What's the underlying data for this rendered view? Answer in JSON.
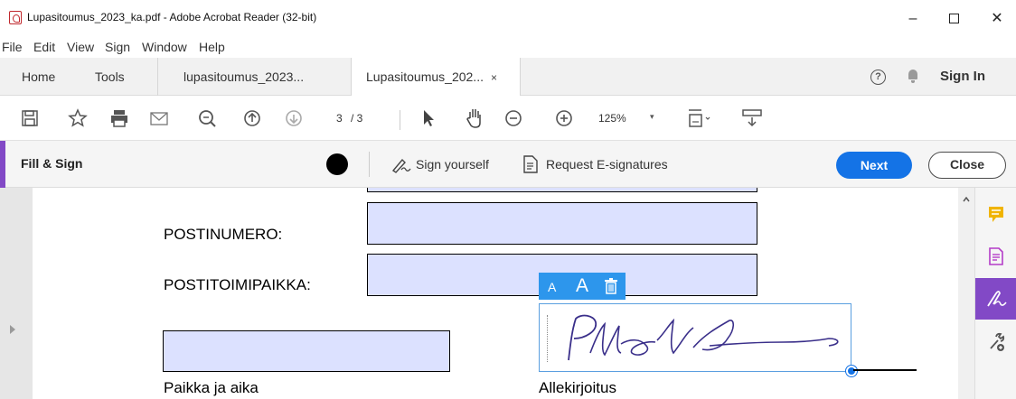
{
  "window": {
    "title": "Lupasitoumus_2023_ka.pdf - Adobe Acrobat Reader (32-bit)",
    "minimize": "–",
    "close": "✕"
  },
  "menu": [
    "File",
    "Edit",
    "View",
    "Sign",
    "Window",
    "Help"
  ],
  "tabs": {
    "home": "Home",
    "tools": "Tools",
    "doc1": "lupasitoumus_2023...",
    "doc2": "Lupasitoumus_202...",
    "doc2_close": "×",
    "help_icon": "?",
    "signin": "Sign In"
  },
  "toolbar": {
    "icons": [
      "save-icon",
      "bookmark-star-icon",
      "print-icon",
      "email-icon",
      "find-zoom-icon",
      "page-up-icon",
      "page-down-icon",
      "select-pointer-icon",
      "hand-tool-icon",
      "zoom-out-icon",
      "zoom-in-icon",
      "fit-page-icon",
      "scroll-mode-icon"
    ],
    "page_current": "3",
    "page_total": "/ 3",
    "zoom": "125%",
    "zoom_caret": "▾"
  },
  "fillsign": {
    "title": "Fill & Sign",
    "sign_yourself": "Sign yourself",
    "request": "Request E-signatures",
    "next": "Next",
    "close": "Close",
    "ink_color": "#000000",
    "accent": "#8249c6"
  },
  "document": {
    "postinumero": "POSTINUMERO:",
    "postitoimipaikka": "POSTITOIMIPAIKKA:",
    "paikka": "Paikka ja aika",
    "allekirjoitus": "Allekirjoitus",
    "field_color": "#dce1ff"
  },
  "sig_tools": {
    "small_a": "A",
    "large_a": "A"
  },
  "side_panel": [
    "comment-icon",
    "export-pdf-icon",
    "fill-sign-icon",
    "more-tools-icon"
  ]
}
